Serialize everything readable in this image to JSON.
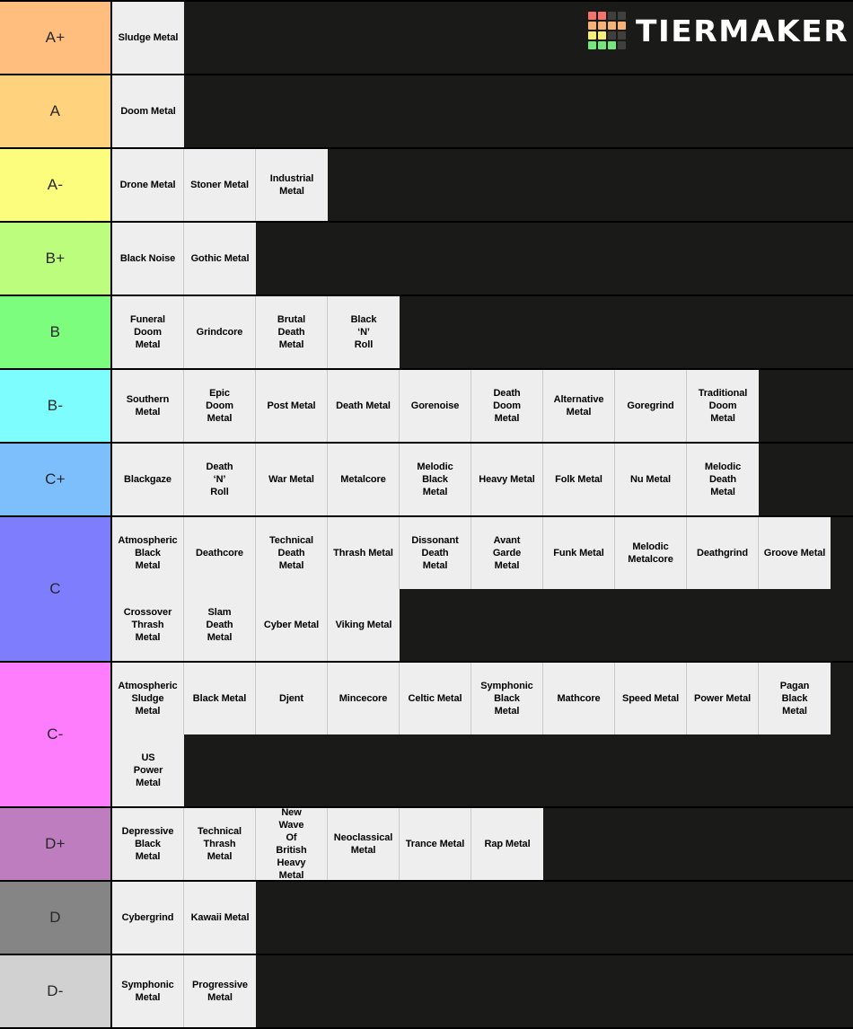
{
  "brand": {
    "name": "TIERMAKER",
    "logo_colors": [
      "#f2746b",
      "#f2746b",
      "#3f3f3d",
      "#3f3f3d",
      "#f7b278",
      "#f7b278",
      "#f7b278",
      "#f7b278",
      "#f5f07a",
      "#f5f07a",
      "#3f3f3d",
      "#3f3f3d",
      "#77e57d",
      "#77e57d",
      "#77e57d",
      "#3f3f3d"
    ]
  },
  "colors": {
    "background": "#1a1a18",
    "item_background": "#eeeeee",
    "border": "#000000",
    "label_text": "#27272a",
    "item_text": "#000000"
  },
  "tiers": [
    {
      "label": "A+",
      "color": "#ffbe7d",
      "lines": [
        [
          "Sludge Metal"
        ]
      ]
    },
    {
      "label": "A",
      "color": "#ffd37d",
      "lines": [
        [
          "Doom Metal"
        ]
      ]
    },
    {
      "label": "A-",
      "color": "#fdfd7d",
      "lines": [
        [
          "Drone Metal",
          "Stoner Metal",
          "Industrial Metal"
        ]
      ]
    },
    {
      "label": "B+",
      "color": "#bdfd7d",
      "lines": [
        [
          "Black Noise",
          "Gothic Metal"
        ]
      ]
    },
    {
      "label": "B",
      "color": "#7dfd7d",
      "lines": [
        [
          "Funeral Doom Metal",
          "Grindcore",
          "Brutal Death Metal",
          "Black ‘N’ Roll"
        ]
      ]
    },
    {
      "label": "B-",
      "color": "#7dfdfd",
      "lines": [
        [
          "Southern Metal",
          "Epic Doom Metal",
          "Post Metal",
          "Death Metal",
          "Gorenoise",
          "Death Doom Metal",
          "Alternative Metal",
          "Goregrind",
          "Traditional Doom Metal"
        ]
      ]
    },
    {
      "label": "C+",
      "color": "#7dbefd",
      "lines": [
        [
          "Blackgaze",
          "Death ‘N’ Roll",
          "War Metal",
          "Metalcore",
          "Melodic Black Metal",
          "Heavy Metal",
          "Folk Metal",
          "Nu Metal",
          "Melodic Death Metal"
        ]
      ]
    },
    {
      "label": "C",
      "color": "#7d7dfd",
      "lines": [
        [
          "Atmospheric Black Metal",
          "Deathcore",
          "Technical Death Metal",
          "Thrash Metal",
          "Dissonant Death Metal",
          "Avant Garde Metal",
          "Funk Metal",
          "Melodic Metalcore",
          "Deathgrind",
          "Groove Metal"
        ],
        [
          "Crossover Thrash Metal",
          "Slam Death Metal",
          "Cyber Metal",
          "Viking Metal"
        ]
      ]
    },
    {
      "label": "C-",
      "color": "#fd7dfd",
      "lines": [
        [
          "Atmospheric Sludge Metal",
          "Black Metal",
          "Djent",
          "Mincecore",
          "Celtic Metal",
          "Symphonic Black Metal",
          "Mathcore",
          "Speed Metal",
          "Power Metal",
          "Pagan Black Metal"
        ],
        [
          "US Power Metal"
        ]
      ]
    },
    {
      "label": "D+",
      "color": "#be7dbe",
      "lines": [
        [
          "Depressive Black Metal",
          "Technical Thrash Metal",
          "New Wave Of British Heavy Metal",
          "Neoclassical Metal",
          "Trance Metal",
          "Rap Metal"
        ]
      ]
    },
    {
      "label": "D",
      "color": "#858585",
      "lines": [
        [
          "Cybergrind",
          "Kawaii Metal"
        ]
      ]
    },
    {
      "label": "D-",
      "color": "#d1d1d1",
      "lines": [
        [
          "Symphonic Metal",
          "Progressive Metal"
        ]
      ]
    }
  ]
}
